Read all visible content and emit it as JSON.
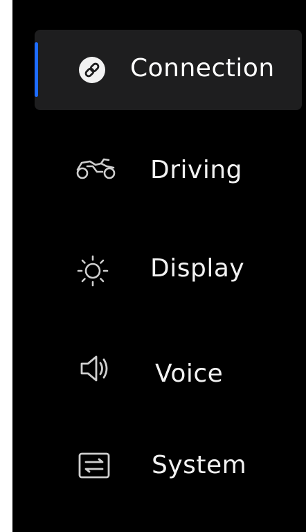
{
  "menu": {
    "items": [
      {
        "id": "connection",
        "label": "Connection",
        "icon": "link-icon",
        "active": true
      },
      {
        "id": "driving",
        "label": "Driving",
        "icon": "motorcycle-icon",
        "active": false
      },
      {
        "id": "display",
        "label": "Display",
        "icon": "brightness-icon",
        "active": false
      },
      {
        "id": "voice",
        "label": "Voice",
        "icon": "speaker-icon",
        "active": false
      },
      {
        "id": "system",
        "label": "System",
        "icon": "settings-toggle-icon",
        "active": false
      }
    ]
  },
  "colors": {
    "background": "#000000",
    "active_item_bg": "#1e1e1f",
    "active_indicator": "#1e6cff",
    "text": "#f2f2f2",
    "icon": "#cfcfcf"
  }
}
